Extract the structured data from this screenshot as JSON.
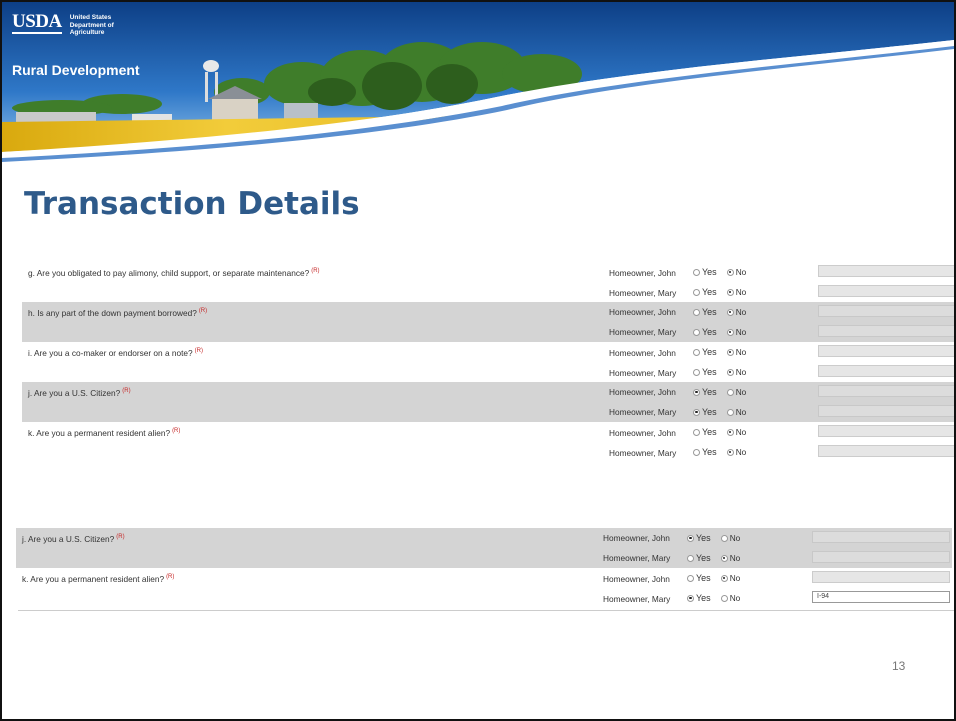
{
  "header": {
    "org_short": "USDA",
    "org_line1": "United States",
    "org_line2": "Department of",
    "org_line3": "Agriculture",
    "agency": "Rural Development"
  },
  "title": "Transaction Details",
  "options": {
    "yes": "Yes",
    "no": "No"
  },
  "form_top": {
    "questions": [
      {
        "text": "g. Are you obligated to pay alimony, child support, or separate maintenance?",
        "req": "(R)",
        "shaded": false,
        "people": [
          {
            "name": "Homeowner, John",
            "answer": "No",
            "field": ""
          },
          {
            "name": "Homeowner, Mary",
            "answer": "No",
            "field": ""
          }
        ]
      },
      {
        "text": "h. Is any part of the down payment borrowed?",
        "req": "(R)",
        "shaded": true,
        "people": [
          {
            "name": "Homeowner, John",
            "answer": "No",
            "field": ""
          },
          {
            "name": "Homeowner, Mary",
            "answer": "No",
            "field": ""
          }
        ]
      },
      {
        "text": "i. Are you a co-maker or endorser on a note?",
        "req": "(R)",
        "shaded": false,
        "people": [
          {
            "name": "Homeowner, John",
            "answer": "No",
            "field": ""
          },
          {
            "name": "Homeowner, Mary",
            "answer": "No",
            "field": ""
          }
        ]
      },
      {
        "text": "j. Are you a U.S. Citizen?",
        "req": "(R)",
        "shaded": true,
        "people": [
          {
            "name": "Homeowner, John",
            "answer": "Yes",
            "field": ""
          },
          {
            "name": "Homeowner, Mary",
            "answer": "Yes",
            "field": ""
          }
        ]
      },
      {
        "text": "k. Are you a permanent resident alien?",
        "req": "(R)",
        "shaded": false,
        "people": [
          {
            "name": "Homeowner, John",
            "answer": "No",
            "field": ""
          },
          {
            "name": "Homeowner, Mary",
            "answer": "No",
            "field": ""
          }
        ]
      }
    ]
  },
  "form_bottom": {
    "questions": [
      {
        "text": "j. Are you a U.S. Citizen?",
        "req": "(R)",
        "shaded": true,
        "people": [
          {
            "name": "Homeowner, John",
            "answer": "Yes",
            "field": ""
          },
          {
            "name": "Homeowner, Mary",
            "answer": "No",
            "field": ""
          }
        ]
      },
      {
        "text": "k. Are you a permanent resident alien?",
        "req": "(R)",
        "shaded": false,
        "people": [
          {
            "name": "Homeowner, John",
            "answer": "No",
            "field": ""
          },
          {
            "name": "Homeowner, Mary",
            "answer": "Yes",
            "field": "I-94"
          }
        ]
      }
    ]
  },
  "page_number": "13",
  "colors": {
    "title": "#2e5a8a",
    "shade": "#d4d4d4",
    "banner_blue": "#1e63b3",
    "required": "#c62828"
  }
}
